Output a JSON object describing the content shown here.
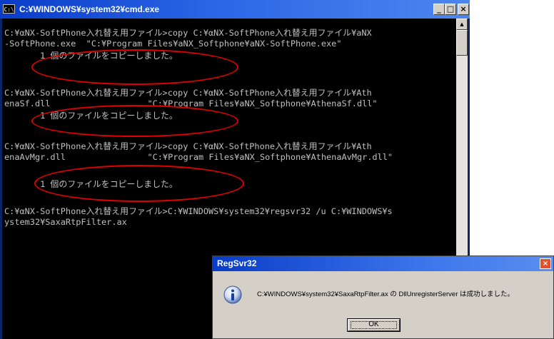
{
  "cmd_window": {
    "icon_text": "C:\\",
    "title": "C:¥WINDOWS¥system32¥cmd.exe",
    "buttons": {
      "minimize": "_",
      "maximize": "□",
      "close": "×"
    },
    "lines": [
      "C:¥αNX-SoftPhone入れ替え用ファイル>copy C:¥αNX-SoftPhone入れ替え用ファイル¥aNX",
      "-SoftPhone.exe  \"C:¥Program Files¥aNX_Softphone¥aNX-SoftPhone.exe\"",
      "       1 個のファイルをコピーしました。",
      "",
      "C:¥αNX-SoftPhone入れ替え用ファイル>copy C:¥αNX-SoftPhone入れ替え用ファイル¥Ath",
      "enaSf.dll                   \"C:¥Program Files¥aNX_Softphone¥AthenaSf.dll\"",
      "       1 個のファイルをコピーしました。",
      "",
      "C:¥αNX-SoftPhone入れ替え用ファイル>copy C:¥αNX-SoftPhone入れ替え用ファイル¥Ath",
      "enaAvMgr.dll                \"C:¥Program Files¥aNX_Softphone¥AthenaAvMgr.dll\"",
      "",
      "       1 個のファイルをコピーしました。",
      "",
      "C:¥αNX-SoftPhone入れ替え用ファイル>C:¥WINDOWS¥system32¥regsvr32 /u C:¥WINDOWS¥s",
      "ystem32¥SaxaRtpFilter.ax"
    ]
  },
  "dialog": {
    "title": "RegSvr32",
    "close": "×",
    "message": "C:¥WINDOWS¥system32¥SaxaRtpFilter.ax の DllUnregisterServer は成功しました。",
    "ok_label": "OK"
  },
  "colors": {
    "highlight_oval": "#e00000",
    "console_bg": "#000000",
    "console_text": "#c0c0c0"
  }
}
